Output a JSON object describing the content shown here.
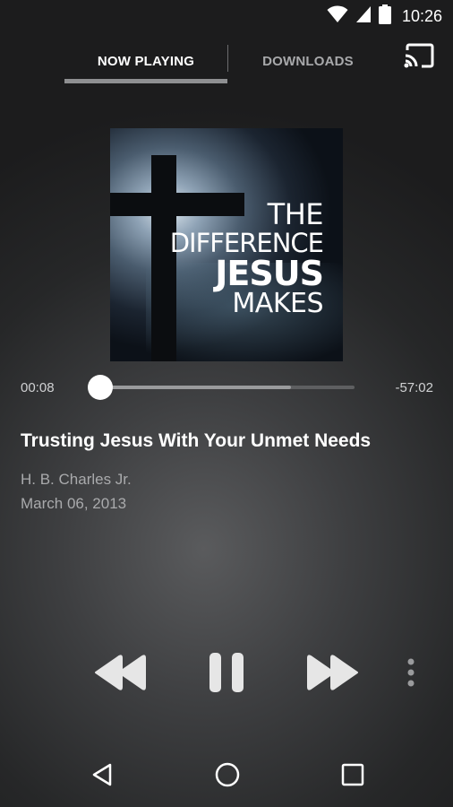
{
  "status_bar": {
    "time": "10:26",
    "icons": [
      "wifi-icon",
      "signal-icon",
      "battery-icon"
    ]
  },
  "tabs": [
    {
      "label": "NOW PLAYING",
      "active": true
    },
    {
      "label": "DOWNLOADS",
      "active": false
    }
  ],
  "toolbar": {
    "cast_icon": "cast-icon"
  },
  "album_art": {
    "line1": "THE",
    "line2": "DIFFERENCE",
    "line3": "JESUS",
    "line4": "MAKES"
  },
  "player": {
    "elapsed": "00:08",
    "remaining": "-57:02",
    "progress": 0.01,
    "buffered": 0.75
  },
  "track": {
    "title": "Trusting Jesus With Your Unmet Needs",
    "artist": "H. B. Charles Jr.",
    "date": "March 06, 2013"
  },
  "controls": [
    "rewind-icon",
    "pause-icon",
    "fast-forward-icon",
    "more-vert-icon"
  ],
  "nav": [
    "back-icon",
    "home-icon",
    "recents-icon"
  ],
  "colors": {
    "accent": "#ffffff",
    "indicator": "#8e8f91",
    "secondary_text": "#a9aaac"
  }
}
